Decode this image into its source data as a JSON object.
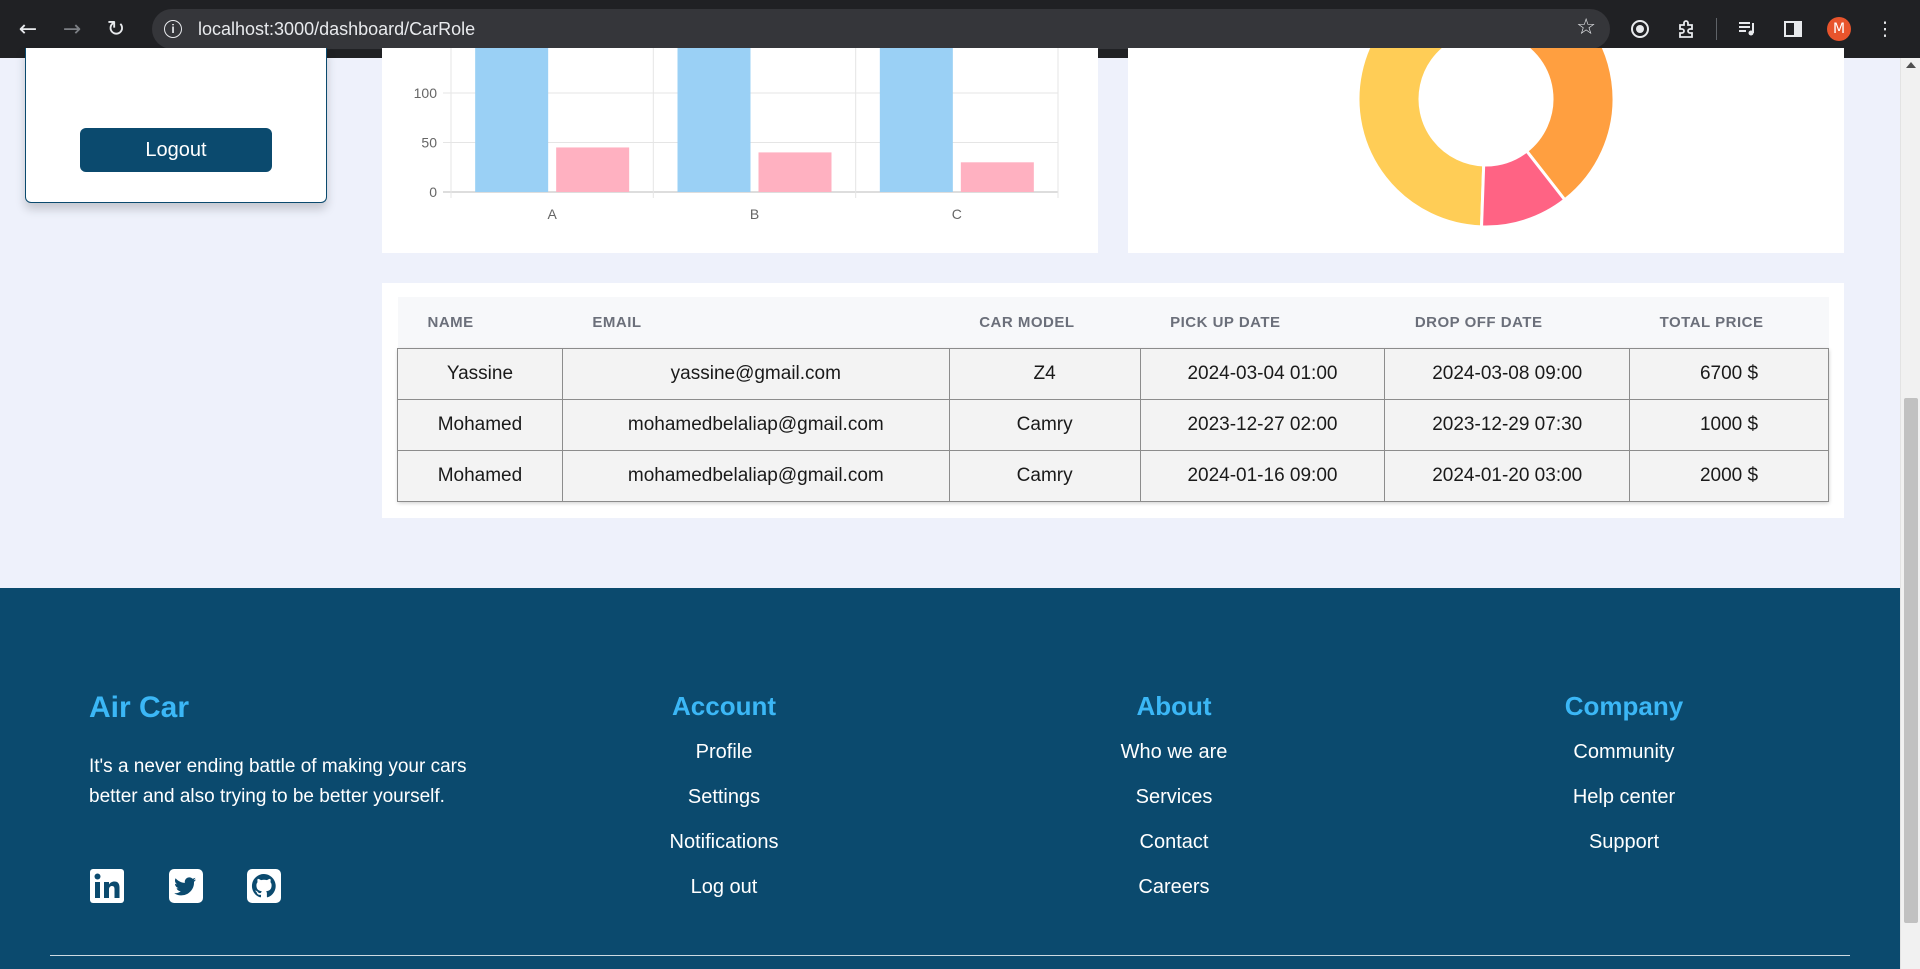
{
  "browser": {
    "url": "localhost:3000/dashboard/CarRole",
    "profile_initial": "M",
    "icons": [
      "back-icon",
      "forward-icon",
      "reload-icon",
      "site-info-icon",
      "bookmark-star-icon",
      "extension-icon",
      "puzzle-icon",
      "media-icon",
      "side-panel-icon",
      "menu-icon"
    ]
  },
  "sidebar": {
    "logout_label": "Logout"
  },
  "chart_data": [
    {
      "type": "bar",
      "categories": [
        "A",
        "B",
        "C"
      ],
      "series": [
        {
          "values": [
            250,
            250,
            250
          ],
          "color": "#9ad0f5"
        },
        {
          "values": [
            45,
            40,
            30
          ],
          "color": "#ffb1c1"
        }
      ],
      "ylim": [
        0,
        150
      ],
      "yticks": [
        0,
        50,
        100
      ],
      "grid": true
    },
    {
      "type": "pie",
      "donut": true,
      "slices": [
        {
          "value": 40,
          "color": "#ffcd56"
        },
        {
          "value": 24,
          "color": "#ff9f40"
        },
        {
          "value": 8,
          "color": "#ff6384"
        }
      ]
    }
  ],
  "table": {
    "headers": [
      "NAME",
      "EMAIL",
      "CAR MODEL",
      "PICK UP DATE",
      "DROP OFF DATE",
      "TOTAL PRICE"
    ],
    "rows": [
      [
        "Yassine",
        "yassine@gmail.com",
        "Z4",
        "2024-03-04 01:00",
        "2024-03-08 09:00",
        "6700 $"
      ],
      [
        "Mohamed",
        "mohamedbelaliap@gmail.com",
        "Camry",
        "2023-12-27 02:00",
        "2023-12-29 07:30",
        "1000 $"
      ],
      [
        "Mohamed",
        "mohamedbelaliap@gmail.com",
        "Camry",
        "2024-01-16 09:00",
        "2024-01-20 03:00",
        "2000 $"
      ]
    ]
  },
  "footer": {
    "brand": "Air Car",
    "tagline": "It's a never ending battle of making your cars better and also trying to be better yourself.",
    "social": [
      "linkedin-icon",
      "twitter-icon",
      "github-icon"
    ],
    "columns": [
      {
        "title": "Account",
        "items": [
          "Profile",
          "Settings",
          "Notifications",
          "Log out"
        ]
      },
      {
        "title": "About",
        "items": [
          "Who we are",
          "Services",
          "Contact",
          "Careers"
        ]
      },
      {
        "title": "Company",
        "items": [
          "Community",
          "Help center",
          "Support"
        ]
      }
    ],
    "colors": {
      "background": "#0b4a6e",
      "accent": "#3bb7f6"
    }
  }
}
